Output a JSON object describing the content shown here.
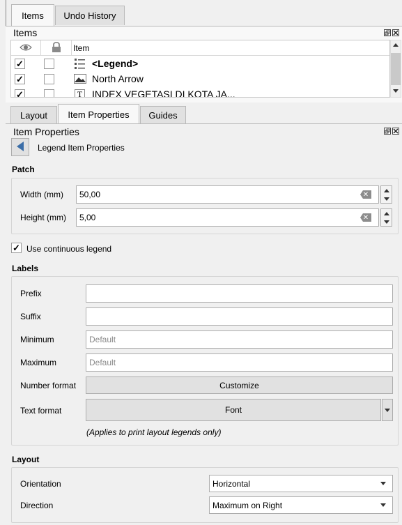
{
  "top_tabs": [
    {
      "label": "Items",
      "active": true
    },
    {
      "label": "Undo History",
      "active": false
    }
  ],
  "items_panel": {
    "title": "Items",
    "column_header": "Item",
    "rows": [
      {
        "label": "<Legend>",
        "visible": true,
        "locked": false,
        "icon": "legend-icon",
        "bold": true
      },
      {
        "label": "North Arrow",
        "visible": true,
        "locked": false,
        "icon": "picture-icon",
        "bold": false
      },
      {
        "label": "INDEX VEGETASI DI KOTA JA...",
        "visible": true,
        "locked": false,
        "icon": "text-label-icon",
        "bold": false
      }
    ]
  },
  "mid_tabs": [
    {
      "label": "Layout",
      "active": false
    },
    {
      "label": "Item Properties",
      "active": true
    },
    {
      "label": "Guides",
      "active": false
    }
  ],
  "item_properties": {
    "title": "Item Properties",
    "subtitle": "Legend Item Properties"
  },
  "patch": {
    "section": "Patch",
    "width_label": "Width (mm)",
    "width_value": "50,00",
    "height_label": "Height (mm)",
    "height_value": "5,00"
  },
  "continuous": {
    "label": "Use continuous legend",
    "checked": true
  },
  "labels": {
    "section": "Labels",
    "prefix_label": "Prefix",
    "prefix_value": "",
    "suffix_label": "Suffix",
    "suffix_value": "",
    "minimum_label": "Minimum",
    "minimum_placeholder": "Default",
    "maximum_label": "Maximum",
    "maximum_placeholder": "Default",
    "number_format_label": "Number format",
    "customize_button": "Customize",
    "text_format_label": "Text format",
    "font_button": "Font",
    "note": "(Applies to print layout legends only)"
  },
  "layout": {
    "section": "Layout",
    "orientation_label": "Orientation",
    "orientation_value": "Horizontal",
    "direction_label": "Direction",
    "direction_value": "Maximum on Right"
  },
  "colors": {
    "accent_blue": "#3c6ea8",
    "checkmark": "#000000"
  }
}
